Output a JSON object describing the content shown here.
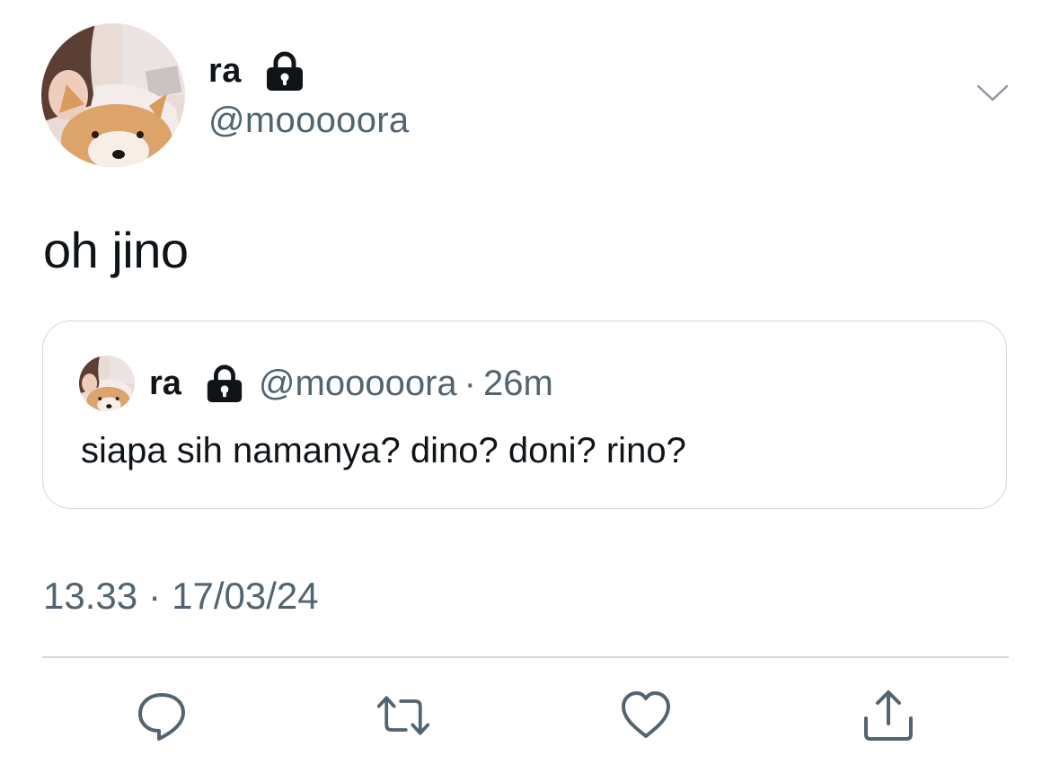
{
  "tweet": {
    "author": {
      "name": "ra",
      "handle": "@mooooora",
      "avatar": "avatar-girl-with-shiba-dog",
      "protected_icon": "lock-icon"
    },
    "text": "oh jino",
    "menu_icon": "chevron-down-icon",
    "quote": {
      "author_name": "ra",
      "author_handle": "@mooooora",
      "separator": "·",
      "time": "26m",
      "text": "siapa sih namanya? dino? doni? rino?"
    },
    "timestamp": {
      "time": "13.33",
      "separator": "·",
      "date": "17/03/24"
    },
    "actions": [
      {
        "name": "reply",
        "icon": "reply-icon"
      },
      {
        "name": "retweet",
        "icon": "retweet-icon"
      },
      {
        "name": "like",
        "icon": "heart-icon"
      },
      {
        "name": "share",
        "icon": "share-icon"
      }
    ]
  },
  "colors": {
    "text": "#0f1419",
    "secondary": "#536471",
    "border": "#cfd9de",
    "icon": "#536471"
  }
}
